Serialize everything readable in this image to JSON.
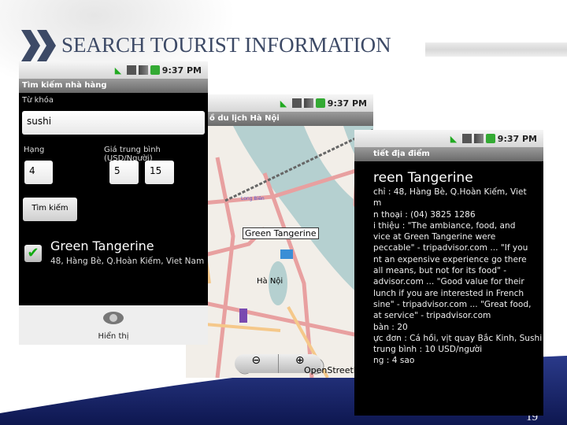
{
  "slide": {
    "title": "SEARCH TOURIST INFORMATION",
    "page_number": "19"
  },
  "status": {
    "time": "9:37 PM"
  },
  "screen1": {
    "title": "Tìm kiếm nhà hàng",
    "keyword_label": "Từ khóa",
    "keyword_value": "sushi",
    "rank_label": "Hạng",
    "rank_value": "4",
    "price_label": "Giá trung bình (USD/Người)",
    "price_min": "5",
    "price_max": "15",
    "search_button": "Tìm kiếm",
    "result": {
      "name": "Green Tangerine",
      "address": "48, Hàng Bè, Q.Hoàn Kiếm, Viet Nam",
      "checked": true
    },
    "show_button": "Hiển thị"
  },
  "screen2": {
    "title": "ồ du lịch Hà Nội",
    "marker_label": "Green Tangerine",
    "city_label": "Hà Nội",
    "place_label": "Long Biên",
    "attribution": "OpenStreetMap"
  },
  "screen3": {
    "title": "tiết địa điểm",
    "name": "reen Tangerine",
    "lines": [
      "chỉ : 48, Hàng Bè, Q.Hoàn Kiếm, Viet",
      "m",
      "n thoại : (04) 3825 1286",
      "i thiệu : \"The ambiance, food, and",
      "vice at Green Tangerine were",
      "peccable\" - tripadvisor.com ... \"If you",
      "nt an expensive experience go there",
      "all means, but not for its food\" -",
      "advisor.com ... \"Good value for their",
      "lunch if you are interested in French",
      "sine\" - tripadvisor.com ... \"Great food,",
      "at service\" - tripadvisor.com",
      "bàn : 20",
      "ực đơn : Cá hồi, vịt quay Bắc Kinh, Sushi",
      "trung bình : 10 USD/người",
      "ng : 4 sao"
    ]
  }
}
